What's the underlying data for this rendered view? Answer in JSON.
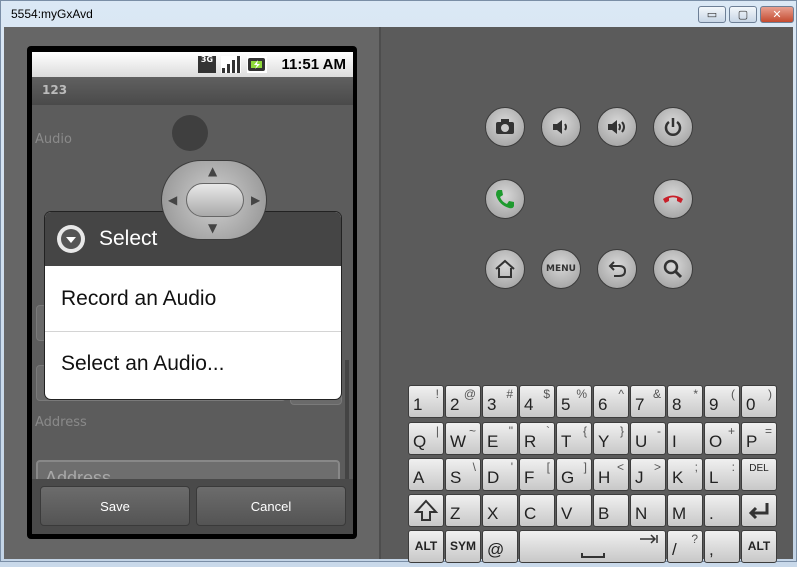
{
  "window": {
    "title": "5554:myGxAvd",
    "min_glyph": "▭",
    "max_glyph": "▢",
    "close_glyph": "✕"
  },
  "phone": {
    "status_bar": {
      "network_label": "3G",
      "time": "11:51 AM"
    },
    "app_title": "123",
    "form": {
      "audio_label": "Audio",
      "address_label": "Address",
      "address_placeholder": "Address",
      "save_label": "Save",
      "cancel_label": "Cancel"
    },
    "dialog": {
      "title": "Select",
      "options": [
        "Record an Audio",
        "Select an Audio..."
      ]
    }
  },
  "controls": {
    "menu_label": "MENU"
  },
  "keyboard": {
    "row1": [
      [
        "1",
        "!"
      ],
      [
        "2",
        "@"
      ],
      [
        "3",
        "#"
      ],
      [
        "4",
        "$"
      ],
      [
        "5",
        "%"
      ],
      [
        "6",
        "^"
      ],
      [
        "7",
        "&"
      ],
      [
        "8",
        "*"
      ],
      [
        "9",
        "("
      ],
      [
        "0",
        ")"
      ]
    ],
    "row2": [
      [
        "Q",
        "|"
      ],
      [
        "W",
        "~"
      ],
      [
        "E",
        "\""
      ],
      [
        "R",
        "`"
      ],
      [
        "T",
        "{"
      ],
      [
        "Y",
        "}"
      ],
      [
        "U",
        "-"
      ],
      [
        "I",
        ""
      ],
      [
        "O",
        "+"
      ],
      [
        "P",
        "="
      ]
    ],
    "row3": [
      [
        "A",
        ""
      ],
      [
        "S",
        "\\"
      ],
      [
        "D",
        "'"
      ],
      [
        "F",
        "["
      ],
      [
        "G",
        "]"
      ],
      [
        "H",
        "<"
      ],
      [
        "J",
        ">"
      ],
      [
        "K",
        ";"
      ],
      [
        "L",
        ":"
      ]
    ],
    "row4": [
      [
        "Z",
        ""
      ],
      [
        "X",
        ""
      ],
      [
        "C",
        ""
      ],
      [
        "V",
        ""
      ],
      [
        "B",
        ""
      ],
      [
        "N",
        ""
      ],
      [
        "M",
        ""
      ],
      [
        ".",
        ""
      ]
    ],
    "del_label": "DEL",
    "alt_label": "ALT",
    "sym_label": "SYM",
    "at_label": "@",
    "slash_label": "/",
    "slash_sec": "?",
    "comma_label": ","
  }
}
